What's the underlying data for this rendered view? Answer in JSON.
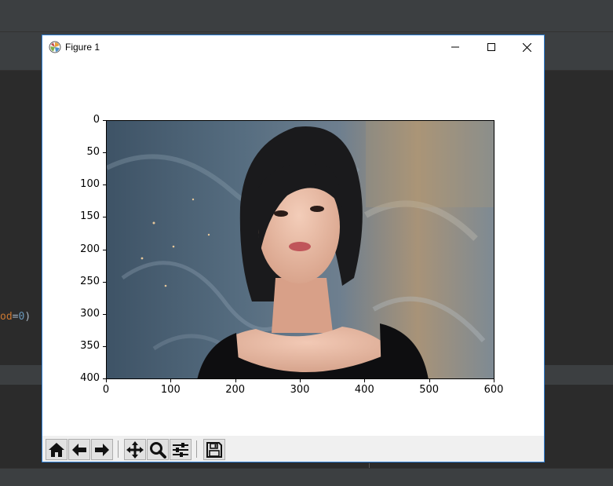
{
  "ide": {
    "code_fragment_keyword": "od",
    "code_fragment_eq": "=",
    "code_fragment_num": "0",
    "code_fragment_close": ")"
  },
  "window": {
    "title": "Figure 1",
    "icons": [
      "matplotlib-icon",
      "minimize-icon",
      "maximize-icon",
      "close-icon"
    ]
  },
  "plot": {
    "x_ticks": [
      "0",
      "100",
      "200",
      "300",
      "400",
      "500",
      "600"
    ],
    "y_ticks": [
      "0",
      "50",
      "100",
      "150",
      "200",
      "250",
      "300",
      "350",
      "400"
    ]
  },
  "toolbar": {
    "buttons": [
      "home-icon",
      "back-icon",
      "forward-icon",
      "pan-icon",
      "zoom-icon",
      "configure-subplots-icon",
      "save-icon"
    ]
  },
  "colors": {
    "accent_border": "#2f7fd4",
    "ide_background": "#2b2b2b",
    "toolbar_background": "#f0f0f0"
  }
}
